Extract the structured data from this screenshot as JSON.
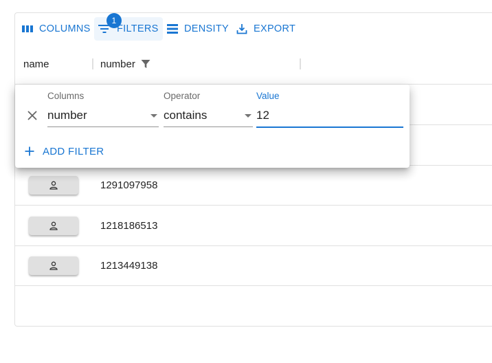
{
  "toolbar": {
    "columns_label": "COLUMNS",
    "filters_label": "FILTERS",
    "filters_badge": "1",
    "density_label": "DENSITY",
    "export_label": "EXPORT"
  },
  "header": {
    "name_label": "name",
    "number_label": "number"
  },
  "rows": [
    {
      "number": "1291097958"
    },
    {
      "number": "1218186513"
    },
    {
      "number": "1213449138"
    }
  ],
  "filter_panel": {
    "columns_label": "Columns",
    "columns_value": "number",
    "operator_label": "Operator",
    "operator_value": "contains",
    "value_label": "Value",
    "value_value": "12",
    "add_filter_label": "ADD FILTER"
  },
  "colors": {
    "primary": "#1976d2",
    "border": "#e0e0e0",
    "button_bg": "#e0e0e0"
  }
}
